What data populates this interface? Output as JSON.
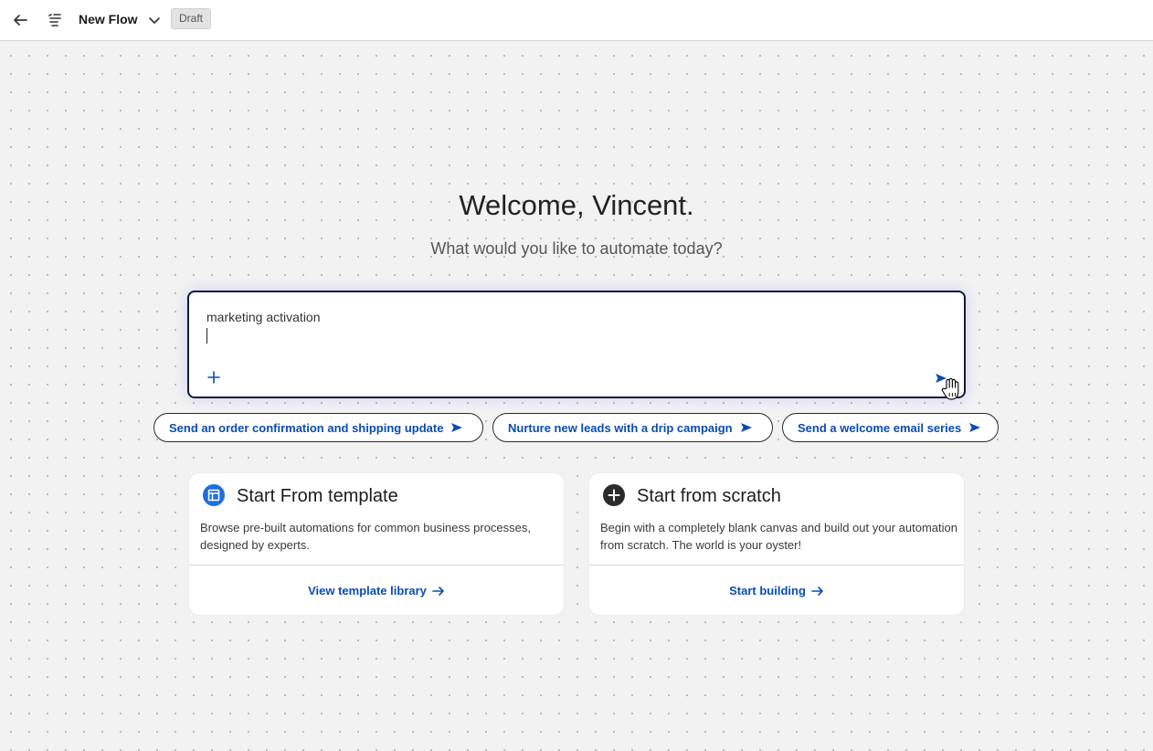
{
  "header": {
    "back_icon": "arrow-left-icon",
    "flows_icon": "flow-list-icon",
    "title": "New Flow",
    "chevron_icon": "chevron-down-icon",
    "status_badge": "Draft"
  },
  "hero": {
    "greeting": "Welcome, Vincent.",
    "subtitle": "What would you like to automate today?"
  },
  "prompt": {
    "value": "marketing activation",
    "add_icon": "plus-icon",
    "send_icon": "send-icon"
  },
  "suggestions": [
    {
      "label": "Send an order confirmation and shipping update"
    },
    {
      "label": "Nurture new leads with a drip campaign"
    },
    {
      "label": "Send a welcome email series"
    }
  ],
  "cards": [
    {
      "icon": "template-icon",
      "title": "Start From template",
      "description": "Browse pre-built automations for common business processes, designed by experts.",
      "link": "View template library"
    },
    {
      "icon": "plus-circle-icon",
      "title": "Start from scratch",
      "description": "Begin with a completely blank canvas and build out your automation from scratch. The world is your oyster!",
      "link": "Start building"
    }
  ],
  "colors": {
    "accent": "#0a4cb5",
    "canvas_bg": "#f2f2f2",
    "prompt_border": "#0d1b3a",
    "template_icon": "#1f6fe0"
  }
}
